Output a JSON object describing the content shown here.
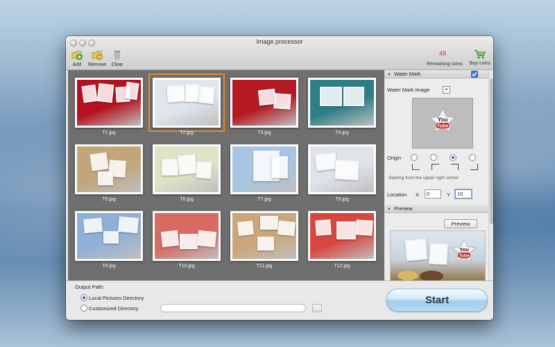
{
  "window": {
    "title": "Image processor"
  },
  "toolbar": {
    "add_label": "Add",
    "remove_label": "Remove",
    "clear_label": "Clear",
    "coins_count": "49",
    "coins_label": "Remaining coins",
    "buy_label": "Buy coins"
  },
  "gallery": {
    "items": [
      {
        "name": "T1.jpg",
        "bg": "#b4121e"
      },
      {
        "name": "T2.jpg",
        "bg": "#dfe6ee",
        "selected": true
      },
      {
        "name": "T3.jpg",
        "bg": "#b51a22"
      },
      {
        "name": "T4.jpg",
        "bg": "#2e7e86"
      },
      {
        "name": "T5.jpg",
        "bg": "#c3a57a"
      },
      {
        "name": "T6.jpg",
        "bg": "#dde5c6"
      },
      {
        "name": "T7.jpg",
        "bg": "#a8c6e4"
      },
      {
        "name": "T8.jpg",
        "bg": "#dfe3ea"
      },
      {
        "name": "T9.jpg",
        "bg": "#8fb0d6"
      },
      {
        "name": "T10.jpg",
        "bg": "#d86a62"
      },
      {
        "name": "T11.jpg",
        "bg": "#caa67a"
      },
      {
        "name": "T12.jpg",
        "bg": "#d8463e"
      }
    ]
  },
  "watermark": {
    "section_label": "Water Mark",
    "checkbox_checked": true,
    "image_label": "Water Mark Image",
    "image_icon": "youtube-star-icon",
    "origin_label": "Origin",
    "origin_selected": 3,
    "origin_hint": "Starting from the upper right corner",
    "location_label": "Location",
    "x_label": "X",
    "x_value": "0",
    "y_label": "Y",
    "y_value": "10"
  },
  "preview": {
    "section_label": "Preview",
    "button_label": "Preview"
  },
  "output": {
    "label": "Output Path:",
    "option_local": "Local Pictures Directory",
    "option_custom": "Customized Directory",
    "selected": "local",
    "path_value": ""
  },
  "start_label": "Start",
  "colors": {
    "accent_selection": "#e88a2a",
    "coins_red": "#d9251d",
    "start_blue": "#9fcdee"
  }
}
